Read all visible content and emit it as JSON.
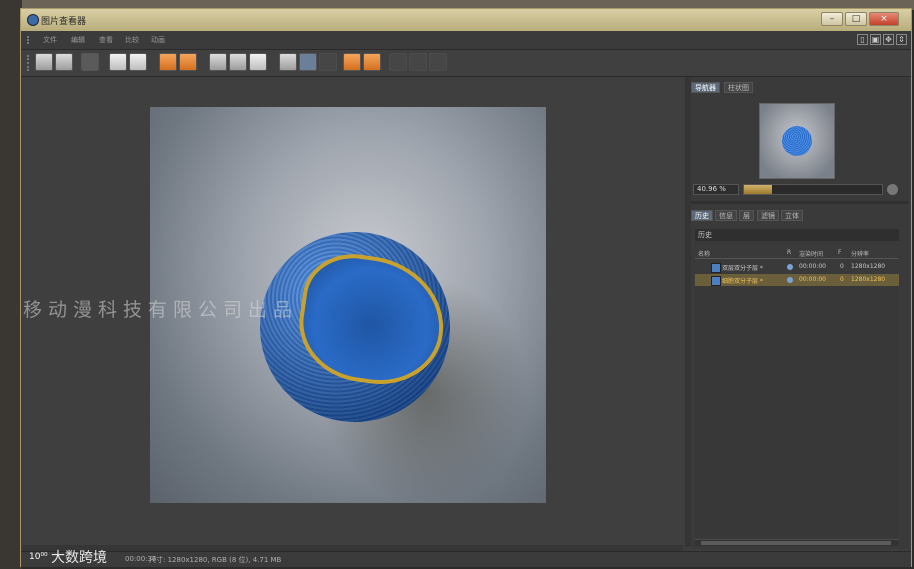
{
  "window": {
    "title": "图片查看器",
    "controls": {
      "minimize": "–",
      "maximize": "□",
      "close": "×"
    }
  },
  "menu": {
    "items": [
      "文件",
      "编辑",
      "查看",
      "比较",
      "动画"
    ]
  },
  "watermark": "移动漫科技有限公司出品",
  "navigator": {
    "tabs": [
      "导航器",
      "柱状图"
    ],
    "active_tab": "导航器",
    "zoom_value": "40.96 %",
    "zoom_level_fraction": 0.2
  },
  "history_panel": {
    "tabs": [
      "历史",
      "信息",
      "层",
      "滤镜",
      "立体"
    ],
    "active_tab": "历史",
    "title": "历史",
    "columns": [
      "名称",
      "R",
      "渲染时间",
      "F",
      "分辨率"
    ],
    "rows": [
      {
        "name": "双层双分子层 *",
        "render_time": "00:00:00",
        "frame": "0",
        "resolution": "1280x1280",
        "selected": false
      },
      {
        "name": "细胞双分子层 *",
        "render_time": "00:00:00",
        "frame": "0",
        "resolution": "1280x1280",
        "selected": true
      }
    ]
  },
  "status": {
    "zoom": "40.96 %",
    "time": "00:00:36",
    "info": "尺寸: 1280x1280, RGB (8 位), 4.71 MB"
  },
  "brand": {
    "logo": "10⁰⁰",
    "text": "大数跨境"
  },
  "colors": {
    "accent": "#c9a22e",
    "selection": "#6a5f3a",
    "window_border": "#a89a66"
  }
}
